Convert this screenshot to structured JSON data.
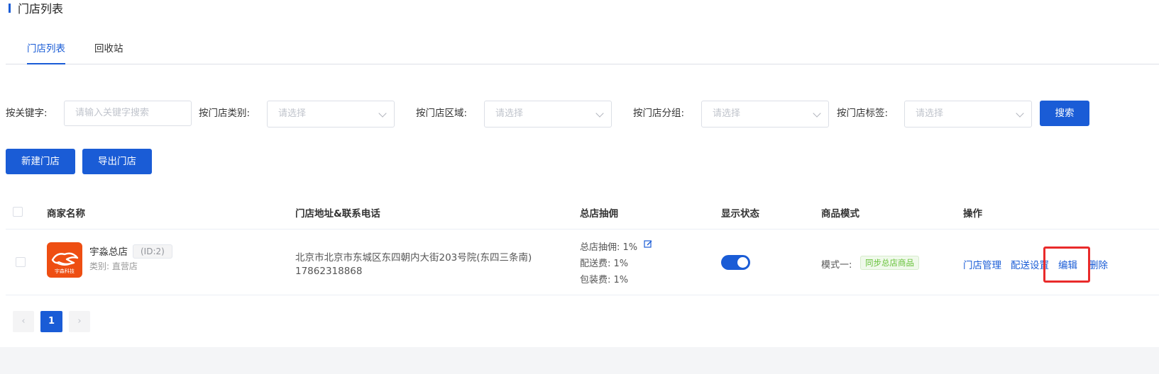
{
  "page": {
    "title": "门店列表"
  },
  "tabs": [
    {
      "label": "门店列表",
      "active": true
    },
    {
      "label": "回收站",
      "active": false
    }
  ],
  "filters": {
    "keyword_label": "按关键字:",
    "keyword_placeholder": "请输入关键字搜索",
    "category_label": "按门店类别:",
    "region_label": "按门店区域:",
    "group_label": "按门店分组:",
    "tag_label": "按门店标签:",
    "select_placeholder": "请选择",
    "search_button": "搜索"
  },
  "actions": {
    "new_store": "新建门店",
    "export_store": "导出门店"
  },
  "table": {
    "headers": [
      "商家名称",
      "门店地址&联系电话",
      "总店抽佣",
      "显示状态",
      "商品模式",
      "操作"
    ],
    "rows": [
      {
        "logo_text": "宇森科技",
        "name": "宇淼总店",
        "id": "(ID:2)",
        "category": "类别: 直营店",
        "address": "北京市北京市东城区东四朝内大街203号院(东四三条南)",
        "phone": "17862318868",
        "fees": [
          "总店抽佣: 1%",
          "配送费: 1%",
          "包装费: 1%"
        ],
        "display_on": true,
        "mode": "模式一:",
        "mode_tag": "同步总店商品",
        "ops": [
          "门店管理",
          "配送设置",
          "编辑",
          "删除"
        ]
      }
    ]
  },
  "pagination": {
    "current": "1",
    "prev": "‹",
    "next": "›"
  },
  "colors": {
    "primary": "#1a5cd6",
    "highlight": "#e92b2b",
    "logo_bg": "#ee4e12",
    "tag_green": "#67c23a"
  }
}
